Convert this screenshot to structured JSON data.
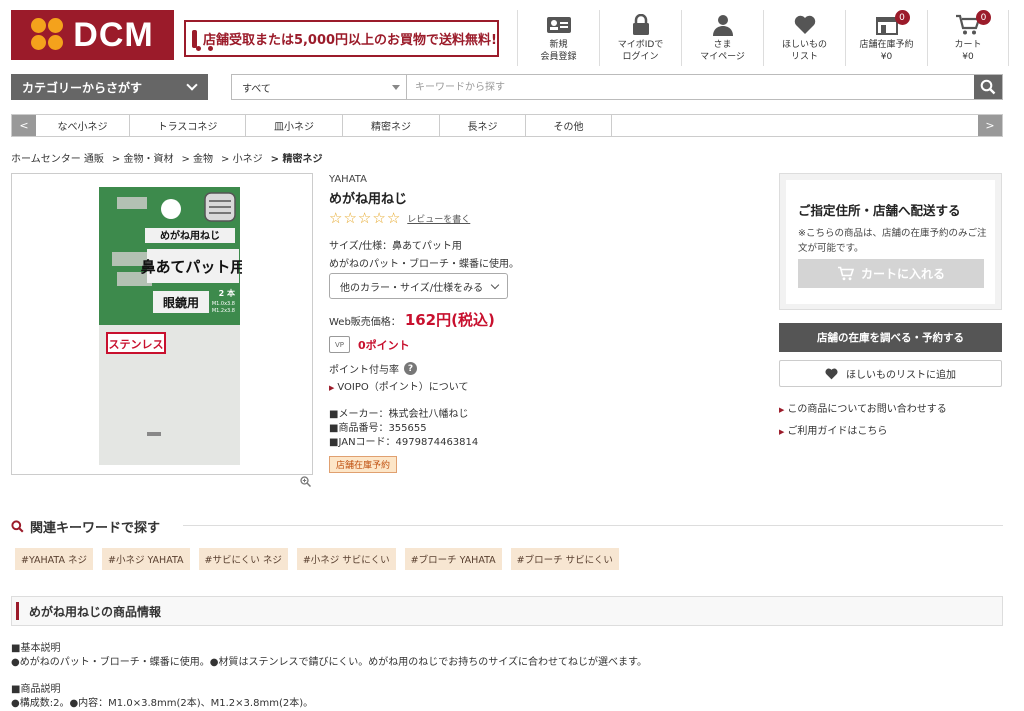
{
  "header": {
    "logo_text": "DCM",
    "promo_text": "店舗受取または5,000円以上のお買物で送料無料!",
    "nav": [
      {
        "label": "新規\n会員登録",
        "icon": "member-card-icon"
      },
      {
        "label": "マイボIDで\nログイン",
        "icon": "lock-icon"
      },
      {
        "label": "さま\nマイページ",
        "icon": "user-icon"
      },
      {
        "label": "ほしいもの\nリスト",
        "icon": "heart-icon"
      },
      {
        "label": "店舗在庫予約\n¥0",
        "icon": "store-icon",
        "badge": "0"
      },
      {
        "label": "カート\n¥0",
        "icon": "cart-icon",
        "badge": "0"
      }
    ]
  },
  "search": {
    "category_button": "カテゴリーからさがす",
    "scope": "すべて",
    "placeholder": "キーワードから探す"
  },
  "subnav": {
    "items": [
      "なべ小ネジ",
      "トラスコネジ",
      "皿小ネジ",
      "精密ネジ",
      "長ネジ",
      "その他"
    ]
  },
  "breadcrumb": [
    "ホームセンター 通販",
    "> 金物・資材",
    "> 金物",
    "> 小ネジ",
    "> 精密ネジ"
  ],
  "product": {
    "brand": "YAHATA",
    "title": "めがね用ねじ",
    "rating": 0,
    "review_link": "レビューを書く",
    "spec1": "サイズ/仕様：鼻あてパット用",
    "spec2": "めがねのパット・ブローチ・蝶番に使用。",
    "variant_button": "他のカラー・サイズ/仕様をみる",
    "price_label": "Web販売価格：",
    "price": "162円(税込)",
    "vp_icon_text": "VP",
    "points": "0ポイント",
    "point_rate_label": "ポイント付与率",
    "voipo_link": "VOIPO（ポイント）について",
    "maker": "■メーカー：株式会社八幡ねじ",
    "item_no": "■商品番号：355655",
    "jan": "■JANコード：4979874463814",
    "store_badge": "店舗在庫予約"
  },
  "package": {
    "label_top": "めがね用ねじ",
    "label_main": "鼻あてパット用",
    "label_sub": "眼鏡用",
    "count": "2 本",
    "size1": "M1.0x3.8",
    "size2": "M1.2x3.8",
    "material": "ステンレス"
  },
  "delivery": {
    "title": "ご指定住所・店舗へ配送する",
    "note": "※こちらの商品は、店舗の在庫予約のみご注文が可能です。",
    "cart_button": "カートに入れる",
    "stock_button": "店舗の在庫を調べる・予約する",
    "wishlist_button": "ほしいものリストに追加",
    "inquiry_link": "この商品についてお問い合わせする",
    "guide_link": "ご利用ガイドはこちら"
  },
  "related": {
    "title": "関連キーワードで探す",
    "tags": [
      "#YAHATA ネジ",
      "#小ネジ YAHATA",
      "#サビにくい ネジ",
      "#小ネジ サビにくい",
      "#ブローチ YAHATA",
      "#ブローチ サビにくい"
    ]
  },
  "info": {
    "title": "めがね用ねじの商品情報",
    "basic_heading": "■基本説明",
    "basic_text": "●めがねのパット・ブローチ・蝶番に使用。●材質はステンレスで錆びにくい。めがね用のねじでお持ちのサイズに合わせてねじが選べます。",
    "desc_heading": "■商品説明",
    "desc_text": "●構成数:2。●内容：M1.0×3.8mm(2本)、M1.2×3.8mm(2本)。"
  },
  "colors": {
    "brand": "#9b1b2a",
    "logo_dots": "#f4a21c",
    "price": "#c8102e",
    "star": "#e6a82a",
    "tag_bg": "#f7e6d2"
  }
}
